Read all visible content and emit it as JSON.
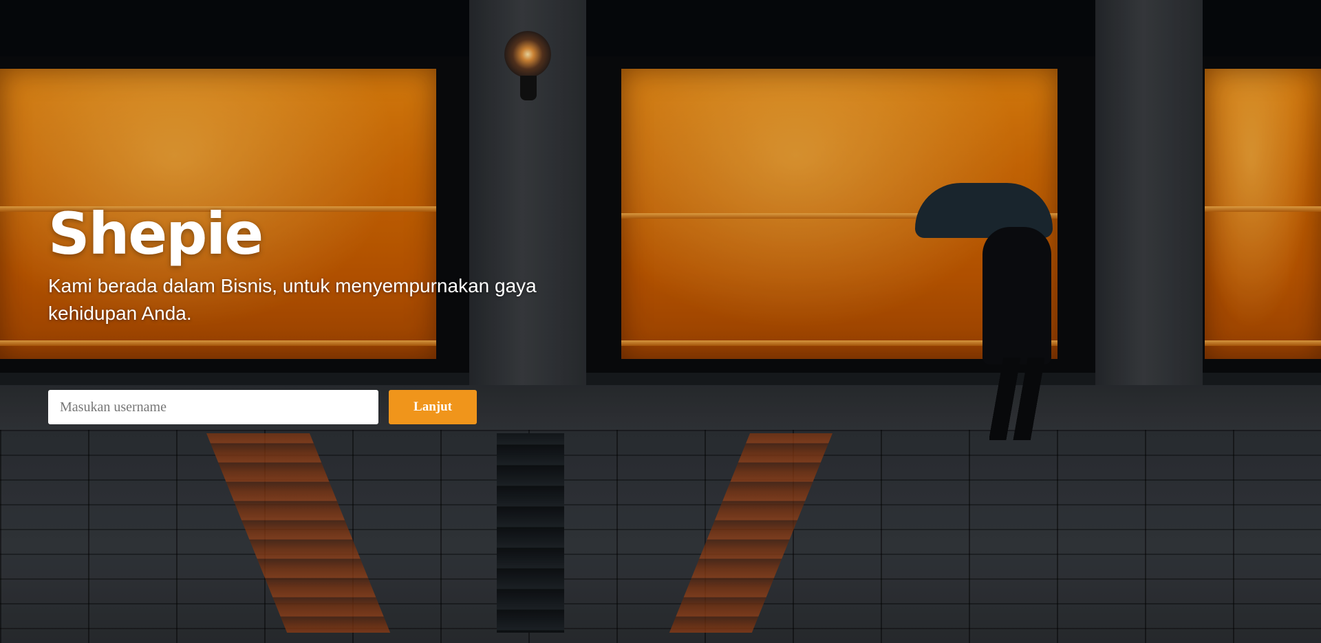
{
  "hero": {
    "brand": "Shepie",
    "tagline": "Kami berada dalam Bisnis, untuk menyempurnakan gaya kehidupan Anda."
  },
  "form": {
    "username_placeholder": "Masukan username",
    "username_value": "",
    "submit_label": "Lanjut"
  },
  "colors": {
    "accent": "#f0951b",
    "text": "#ffffff"
  }
}
